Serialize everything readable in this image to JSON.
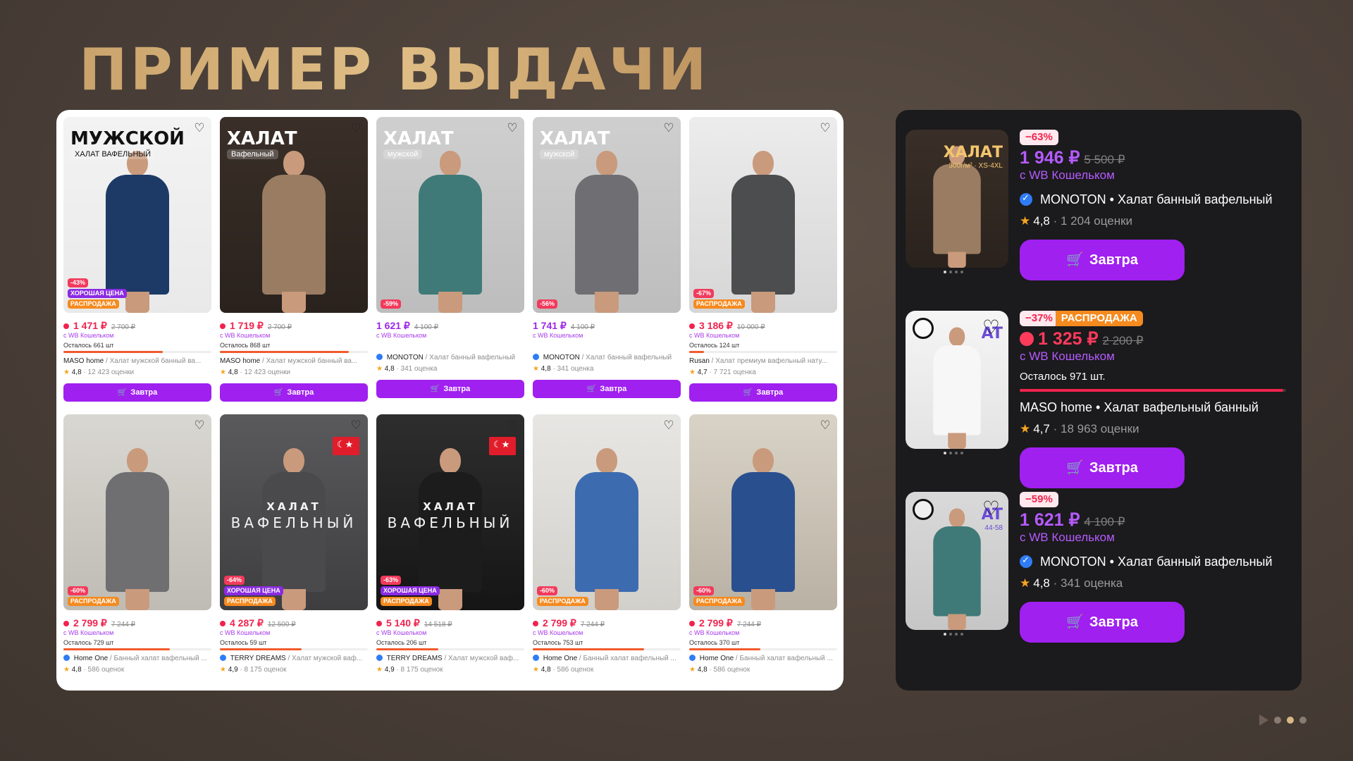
{
  "slide": {
    "title": "ПРИМЕР ВЫДАЧИ"
  },
  "colors": {
    "accent": "#a020f0",
    "sale": "#f58a1f",
    "discount": "#f0234d",
    "title_gold": "#d5b07a"
  },
  "grid": {
    "cards": [
      {
        "img_title": "МУЖСКОЙ ХАЛАТ ВАФЕЛЬНЫЙ",
        "img_top": "МУЖСКОЙ",
        "img_sub": "ХАЛАТ ВАФЕЛЬНЫЙ",
        "badges": [
          "-43%",
          "ХОРОШАЯ ЦЕНА",
          "РАСПРОДАЖА"
        ],
        "price": "1 471 ₽",
        "old_price": "2 700 ₽",
        "wallet": "с WB Кошельком",
        "stock": "Осталось 661 шт",
        "brand": "MASO home",
        "title": " / Халат мужской банный ва...",
        "rating": "4,8",
        "reviews": "· 12 423 оценки",
        "button": "Завтра"
      },
      {
        "img_top": "ХАЛАТ",
        "img_sub": "Вафельный",
        "badges": [],
        "price": "1 719 ₽",
        "old_price": "2 700 ₽",
        "wallet": "с WB Кошельком",
        "stock": "Осталось 868 шт",
        "brand": "MASO home",
        "title": " / Халат мужской банный ва...",
        "rating": "4,8",
        "reviews": "· 12 423 оценки",
        "button": "Завтра"
      },
      {
        "img_top": "ХАЛАТ",
        "img_sub": "мужской",
        "badges": [
          "-59%"
        ],
        "price": "1 621 ₽",
        "old_price": "4 100 ₽",
        "wallet": "с WB Кошельком",
        "stock": "",
        "brand": "MONOTON",
        "title": " / Халат банный вафельный",
        "rating": "4,8",
        "reviews": "· 341 оценка",
        "button": "Завтра"
      },
      {
        "img_top": "ХАЛАТ",
        "img_sub": "мужской",
        "badges": [
          "-56%"
        ],
        "price": "1 741 ₽",
        "old_price": "4 100 ₽",
        "wallet": "с WB Кошельком",
        "stock": "",
        "brand": "MONOTON",
        "title": " / Халат банный вафельный",
        "rating": "4,8",
        "reviews": "· 341 оценка",
        "button": "Завтра"
      },
      {
        "img_top": "",
        "img_sub": "",
        "badges": [
          "-67%",
          "РАСПРОДАЖА"
        ],
        "price": "3 186 ₽",
        "old_price": "10 000 ₽",
        "wallet": "с WB Кошельком",
        "stock": "Осталось 124 шт",
        "brand": "Rusan",
        "title": " / Халат премиум вафельный нату...",
        "rating": "4,7",
        "reviews": "· 7 721 оценка",
        "button": "Завтра"
      },
      {
        "img_top": "",
        "img_sub": "",
        "badges": [
          "-60%",
          "РАСПРОДАЖА"
        ],
        "price": "2 799 ₽",
        "old_price": "7 244 ₽",
        "wallet": "с WB Кошельком",
        "stock": "Осталось 729 шт",
        "brand": "Home One",
        "title": " / Банный халат вафельный ...",
        "rating": "4,8",
        "reviews": "· 586 оценок",
        "button": ""
      },
      {
        "img_center_a": "ХАЛАТ",
        "img_center_b": "ВАФЕЛЬНЫЙ",
        "badges": [
          "-64%",
          "ХОРОШАЯ ЦЕНА",
          "РАСПРОДАЖА"
        ],
        "price": "4 287 ₽",
        "old_price": "12 500 ₽",
        "wallet": "с WB Кошельком",
        "stock": "Осталось 59 шт",
        "brand": "TERRY DREAMS",
        "title": " / Халат мужской ваф...",
        "rating": "4,9",
        "reviews": "· 8 175 оценок",
        "button": ""
      },
      {
        "img_center_a": "ХАЛАТ",
        "img_center_b": "ВАФЕЛЬНЫЙ",
        "badges": [
          "-63%",
          "ХОРОШАЯ ЦЕНА",
          "РАСПРОДАЖА"
        ],
        "price": "5 140 ₽",
        "old_price": "14 518 ₽",
        "wallet": "с WB Кошельком",
        "stock": "Осталось 206 шт",
        "brand": "TERRY DREAMS",
        "title": " / Халат мужской ваф...",
        "rating": "4,9",
        "reviews": "· 8 175 оценок",
        "button": ""
      },
      {
        "img_top": "",
        "img_sub": "",
        "badges": [
          "-60%",
          "РАСПРОДАЖА"
        ],
        "price": "2 799 ₽",
        "old_price": "7 244 ₽",
        "wallet": "с WB Кошельком",
        "stock": "Осталось 753 шт",
        "brand": "Home One",
        "title": " / Банный халат вафельный ...",
        "rating": "4,8",
        "reviews": "· 586 оценок",
        "button": ""
      },
      {
        "img_top": "",
        "img_sub": "",
        "badges": [
          "-60%",
          "РАСПРОДАЖА"
        ],
        "price": "2 799 ₽",
        "old_price": "7 244 ₽",
        "wallet": "с WB Кошельком",
        "stock": "Осталось 370 шт",
        "brand": "Home One",
        "title": " / Банный халат вафельный ...",
        "rating": "4,8",
        "reviews": "· 586 оценок",
        "button": ""
      }
    ]
  },
  "preview": {
    "items": [
      {
        "discount": "−63%",
        "sale": "",
        "price": "1 946 ₽",
        "old_price": "5 500 ₽",
        "wallet": "с WB Кошельком",
        "stock": "",
        "seller": "MONOTON • Халат банный вафельный",
        "rating": "4,8",
        "reviews": "· 1 204 оценки",
        "button": "Завтра",
        "img_top": "ХАЛАТ",
        "img_sub": "300г/м² · XS-4XL"
      },
      {
        "discount": "−37%",
        "sale": "РАСПРОДАЖА",
        "price": "1 325 ₽",
        "old_price": "2 200 ₽",
        "wallet": "с WB Кошельком",
        "stock": "Осталось 971 шт.",
        "seller": "MASO home • Халат вафельный банный",
        "rating": "4,7",
        "reviews": "· 18 963 оценки",
        "button": "Завтра",
        "img_top": "AT",
        "img_sub": ""
      },
      {
        "discount": "−59%",
        "sale": "",
        "price": "1 621 ₽",
        "old_price": "4 100 ₽",
        "wallet": "с WB Кошельком",
        "stock": "",
        "seller": "MONOTON • Халат банный вафельный",
        "rating": "4,8",
        "reviews": "· 341 оценка",
        "button": "Завтра",
        "img_top": "AT",
        "img_sub": "44-58"
      }
    ]
  }
}
